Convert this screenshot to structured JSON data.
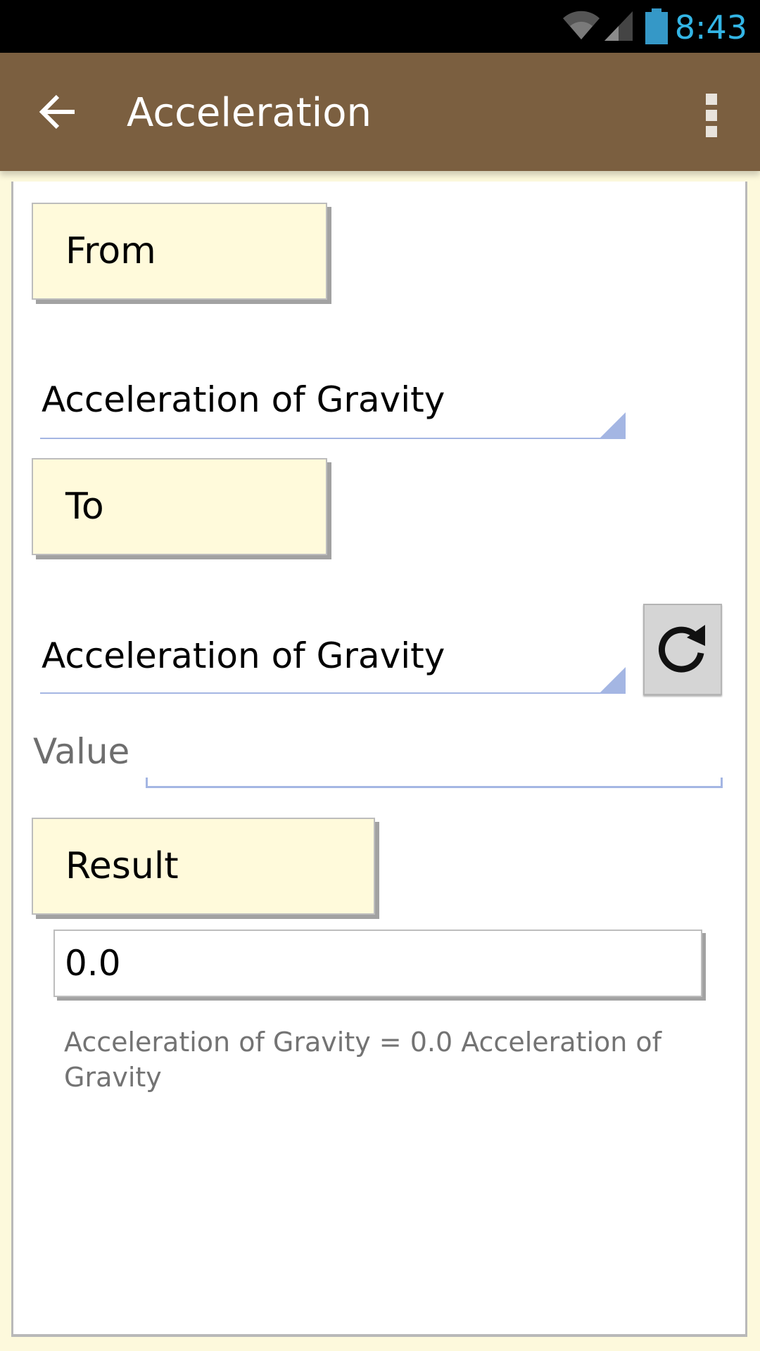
{
  "status_bar": {
    "time": "8:43",
    "icons": [
      "wifi-icon",
      "cell-signal-icon",
      "battery-icon"
    ]
  },
  "action_bar": {
    "title": "Acceleration",
    "back_icon": "arrow-left-icon",
    "overflow_icon": "more-vertical-icon",
    "background_color": "#7b5f40"
  },
  "form": {
    "from_label": "From",
    "from_unit": "Acceleration of Gravity",
    "to_label": "To",
    "to_unit": "Acceleration of Gravity",
    "swap_icon": "refresh-icon",
    "value_label": "Value",
    "value_input": "",
    "result_label": "Result",
    "result_value": "0.0",
    "summary": "Acceleration of Gravity = 0.0 Acceleration of Gravity"
  },
  "colors": {
    "label_box": "#fffadb",
    "accent_underline": "#a4b6e3",
    "time_text": "#33b5e5"
  }
}
